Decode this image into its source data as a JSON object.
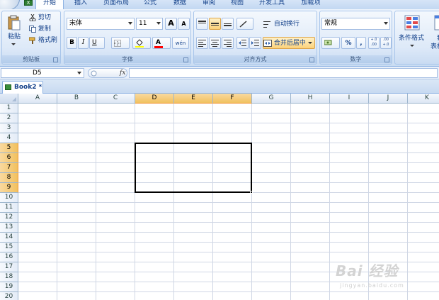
{
  "ribbon_tabs": [
    "开始",
    "插入",
    "页面布局",
    "公式",
    "数据",
    "审阅",
    "视图",
    "开发工具",
    "加载项"
  ],
  "clipboard": {
    "paste_label": "粘贴",
    "cut_label": "剪切",
    "copy_label": "复制",
    "format_painter_label": "格式刷",
    "group_label": "剪贴板"
  },
  "font": {
    "font_name": "宋体",
    "font_size": "11",
    "bold": "B",
    "italic": "I",
    "underline": "U",
    "grow_font": "A",
    "shrink_font": "A",
    "phonetic": "wén",
    "font_color_letter": "A",
    "group_label": "字体"
  },
  "alignment": {
    "wrap_text_label": "自动换行",
    "merge_center_label": "合并后居中",
    "group_label": "对齐方式"
  },
  "number": {
    "format_value": "常规",
    "percent": "%",
    "comma": ",",
    "increase_decimal": "+.0 .00",
    "decrease_decimal": ".00 +.0",
    "group_label": "数字"
  },
  "styles": {
    "conditional_format_label": "条件格式",
    "format_table_label_1": "套",
    "format_table_label_2": "表格"
  },
  "formula_bar": {
    "name_box_value": "D5",
    "fx_label": "fx"
  },
  "workbook": {
    "tab_label": "Book2 *"
  },
  "grid": {
    "columns": [
      "A",
      "B",
      "C",
      "D",
      "E",
      "F",
      "G",
      "H",
      "I",
      "J",
      "K"
    ],
    "rows": [
      "1",
      "2",
      "3",
      "4",
      "5",
      "6",
      "7",
      "8",
      "9",
      "10",
      "11",
      "12",
      "13",
      "14",
      "15",
      "16",
      "17",
      "18",
      "19",
      "20"
    ],
    "selected_columns": [
      "D",
      "E",
      "F"
    ],
    "selected_rows": [
      "5",
      "6",
      "7",
      "8",
      "9"
    ],
    "active_cell": "D5"
  },
  "watermark": {
    "main": "Bai 经验",
    "sub": "jingyan.baidu.com"
  },
  "colors": {
    "selected_header": "#f1c15f",
    "grid_line": "#d0d7e5",
    "ribbon_text": "#15428b"
  }
}
